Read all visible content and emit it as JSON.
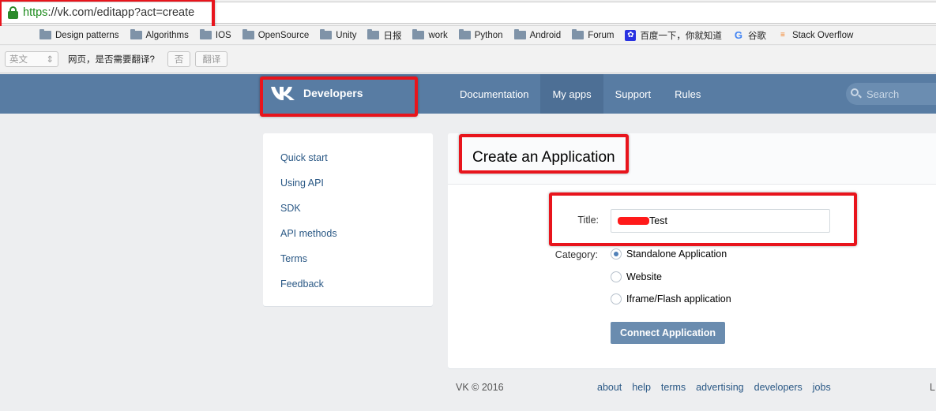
{
  "browser": {
    "url_scheme": "https",
    "url_rest": "://vk.com/editapp?act=create",
    "bookmarks": [
      {
        "label": "Design patterns",
        "icon": "folder-icon"
      },
      {
        "label": "Algorithms",
        "icon": "folder-icon"
      },
      {
        "label": "IOS",
        "icon": "folder-icon"
      },
      {
        "label": "OpenSource",
        "icon": "folder-icon"
      },
      {
        "label": "Unity",
        "icon": "folder-icon"
      },
      {
        "label": "日报",
        "icon": "folder-icon"
      },
      {
        "label": "work",
        "icon": "folder-icon"
      },
      {
        "label": "Python",
        "icon": "folder-icon"
      },
      {
        "label": "Android",
        "icon": "folder-icon"
      },
      {
        "label": "Forum",
        "icon": "folder-icon"
      },
      {
        "label": "百度一下，你就知道",
        "icon": "baidu-paw-icon"
      },
      {
        "label": "谷歌",
        "icon": "google-icon"
      },
      {
        "label": "Stack Overflow",
        "icon": "stackoverflow-icon"
      }
    ],
    "translate": {
      "language": "英文",
      "prompt": "网页，是否需要翻译?",
      "no_label": "否",
      "translate_label": "翻译"
    }
  },
  "header": {
    "brand": "Developers",
    "nav": [
      "Documentation",
      "My apps",
      "Support",
      "Rules"
    ],
    "active_nav": "My apps",
    "search_placeholder": "Search",
    "color": "#587ca3"
  },
  "sidebar": {
    "items": [
      "Quick start",
      "Using API",
      "SDK",
      "API methods",
      "Terms",
      "Feedback"
    ]
  },
  "form": {
    "heading": "Create an Application",
    "title_label": "Title:",
    "title_value": "Test",
    "category_label": "Category:",
    "categories": [
      "Standalone Application",
      "Website",
      "Iframe/Flash application"
    ],
    "selected_category": "Standalone Application",
    "submit_label": "Connect Application"
  },
  "footer": {
    "copyright": "VK © 2016",
    "links": [
      "about",
      "help",
      "terms",
      "advertising",
      "developers",
      "jobs"
    ],
    "lang_fragment": "L"
  },
  "annotation_color": "#e8141c"
}
